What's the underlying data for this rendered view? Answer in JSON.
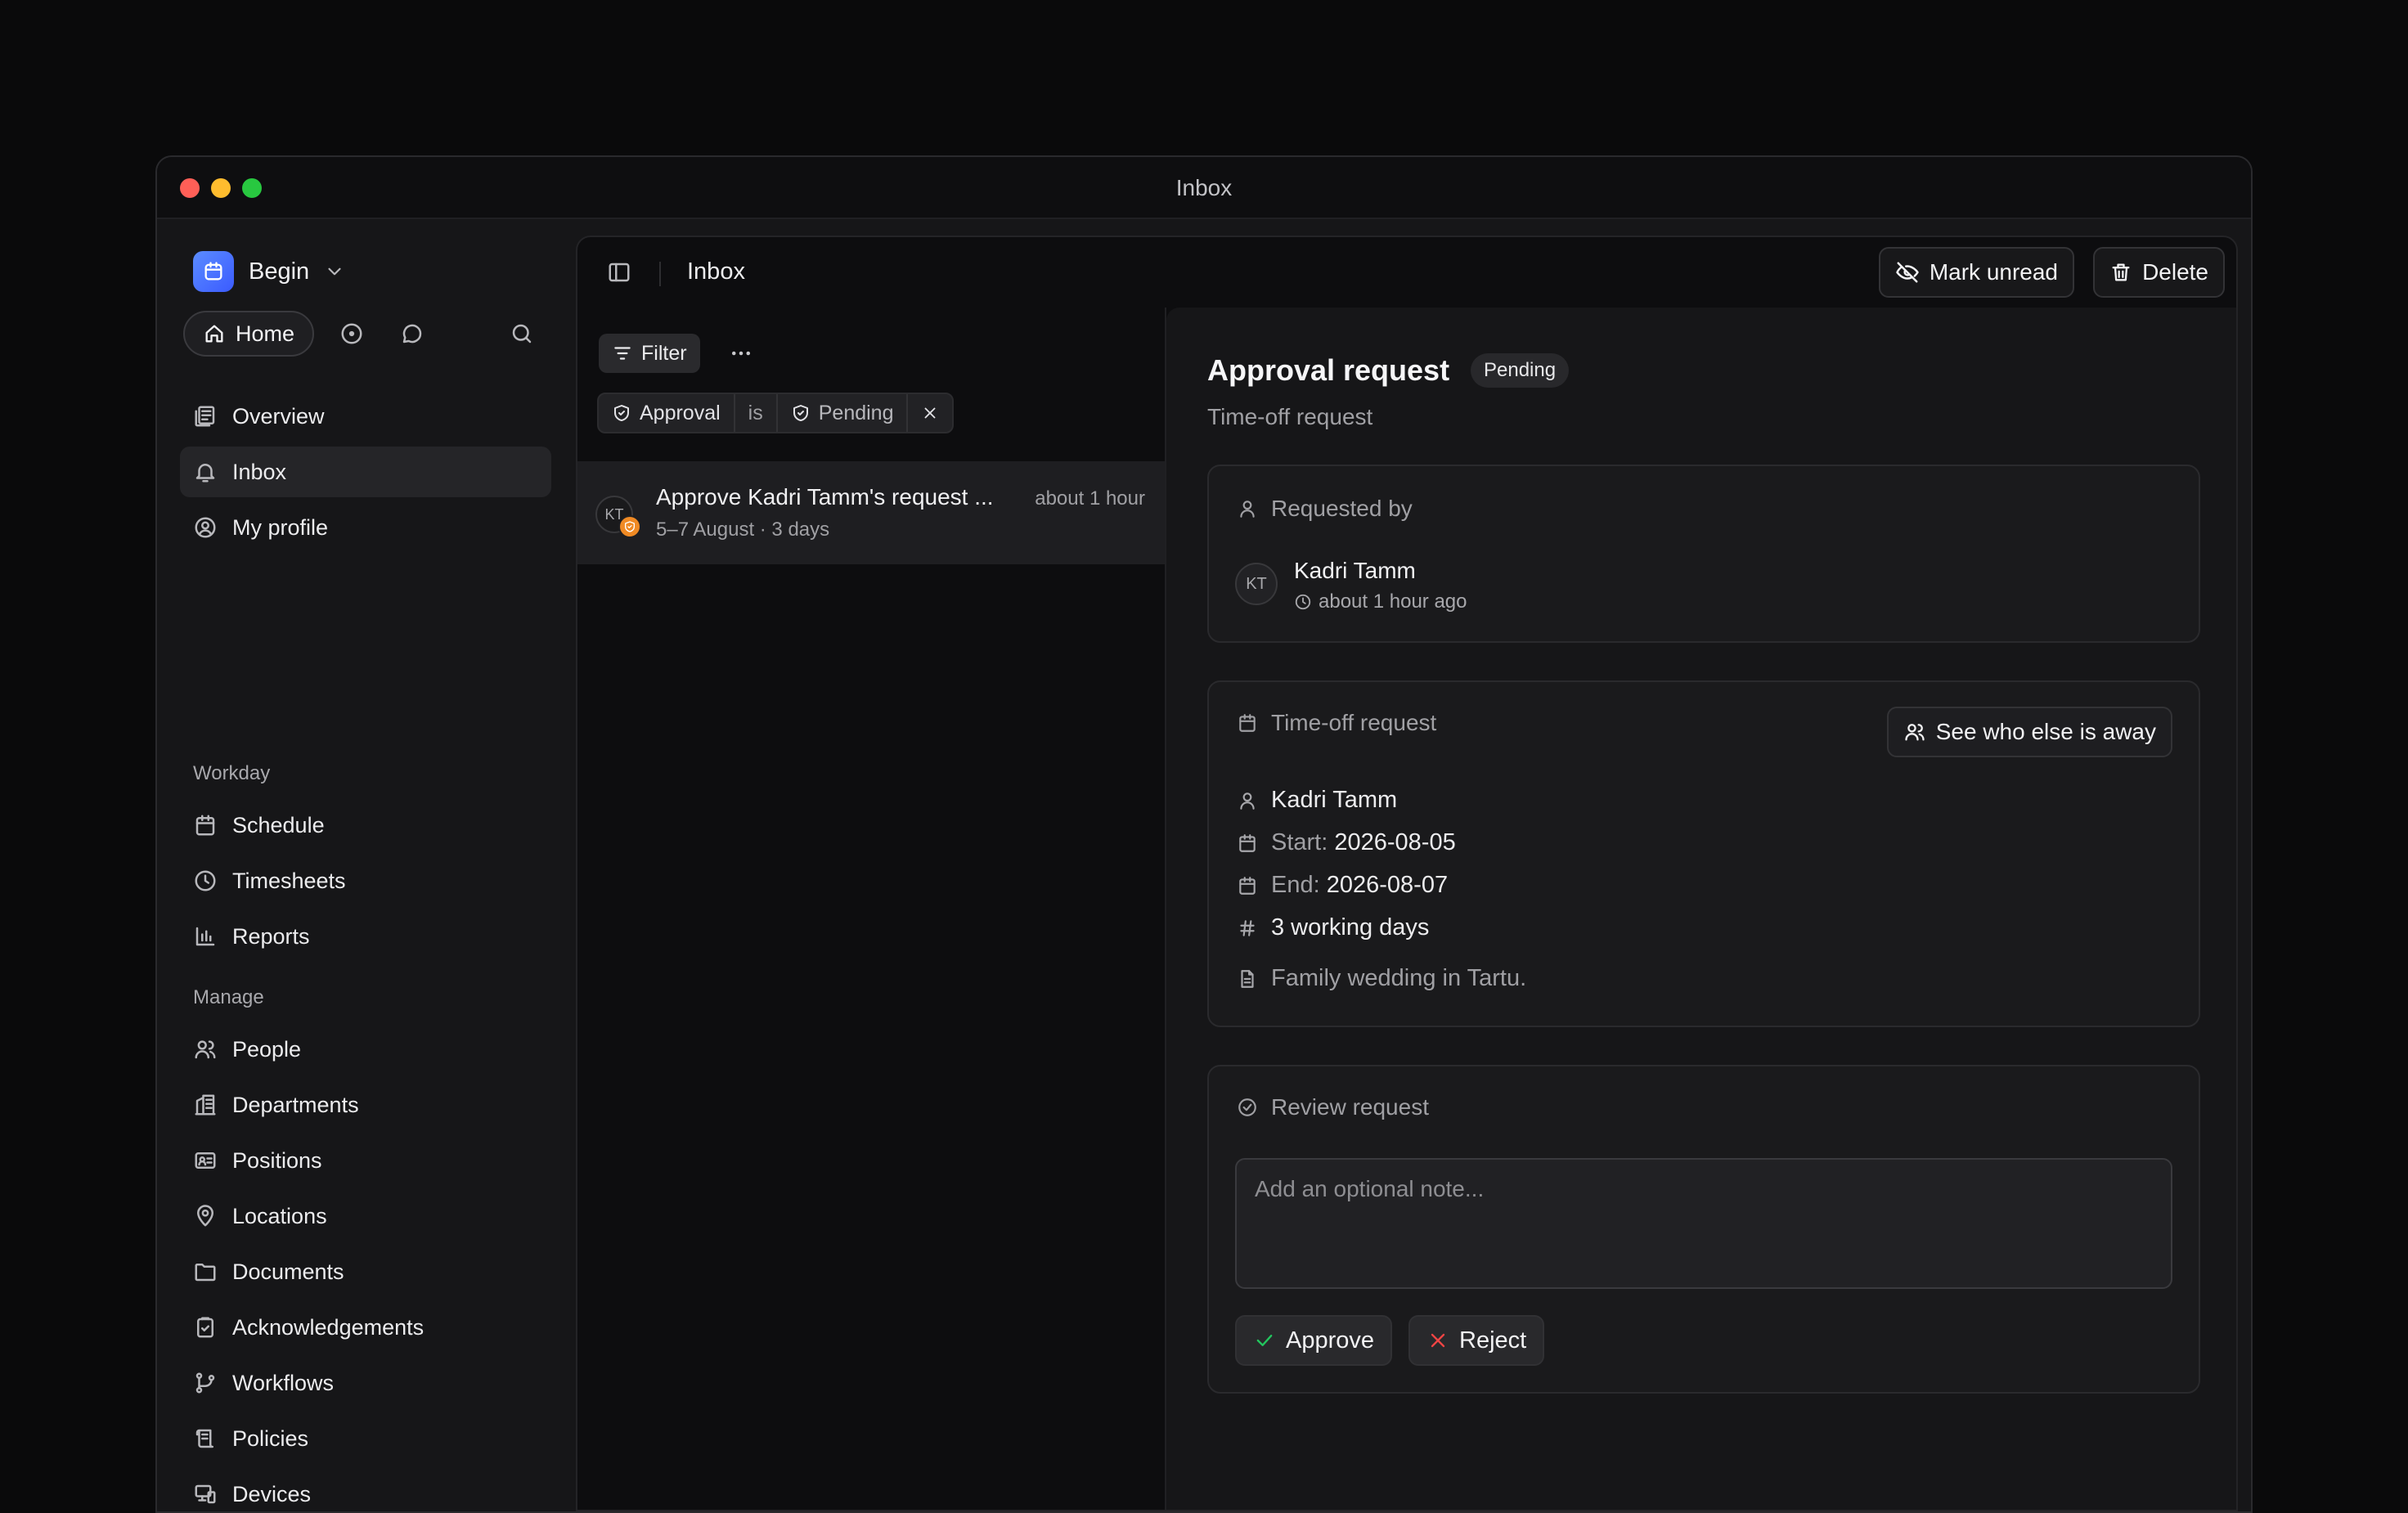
{
  "window": {
    "title": "Inbox"
  },
  "sidebar": {
    "workspace": "Begin",
    "home_label": "Home",
    "items_top": [
      {
        "label": "Overview",
        "icon": "overview-icon"
      },
      {
        "label": "Inbox",
        "icon": "bell-icon",
        "active": true
      },
      {
        "label": "My profile",
        "icon": "user-circle-icon"
      }
    ],
    "section_workday": "Workday",
    "items_workday": [
      {
        "label": "Schedule",
        "icon": "calendar-icon"
      },
      {
        "label": "Timesheets",
        "icon": "clock-icon"
      },
      {
        "label": "Reports",
        "icon": "bar-chart-icon"
      }
    ],
    "section_manage": "Manage",
    "items_manage": [
      {
        "label": "People",
        "icon": "users-icon"
      },
      {
        "label": "Departments",
        "icon": "building-icon"
      },
      {
        "label": "Positions",
        "icon": "id-card-icon"
      },
      {
        "label": "Locations",
        "icon": "map-pin-icon"
      },
      {
        "label": "Documents",
        "icon": "folder-icon"
      },
      {
        "label": "Acknowledgements",
        "icon": "clipboard-check-icon"
      },
      {
        "label": "Workflows",
        "icon": "git-branch-icon"
      },
      {
        "label": "Policies",
        "icon": "scroll-icon"
      },
      {
        "label": "Devices",
        "icon": "devices-icon"
      }
    ]
  },
  "main": {
    "title": "Inbox",
    "mark_unread_label": "Mark unread",
    "delete_label": "Delete"
  },
  "list": {
    "filter_label": "Filter",
    "chip": {
      "field": "Approval",
      "op": "is",
      "value": "Pending"
    },
    "item": {
      "avatar": "KT",
      "title": "Approve Kadri Tamm's request ...",
      "time": "about 1 hour",
      "subtitle": "5–7 August · 3 days"
    }
  },
  "detail": {
    "title": "Approval request",
    "status": "Pending",
    "subtitle": "Time-off request",
    "requested_by": {
      "header": "Requested by",
      "avatar": "KT",
      "name": "Kadri Tamm",
      "time": "about 1 hour ago"
    },
    "timeoff": {
      "header": "Time-off request",
      "see_label": "See who else is away",
      "person": "Kadri Tamm",
      "start_label": "Start:",
      "start": "2026-08-05",
      "end_label": "End:",
      "end": "2026-08-07",
      "days": "3 working days",
      "note": "Family wedding in Tartu."
    },
    "review": {
      "header": "Review request",
      "placeholder": "Add an optional note...",
      "approve_label": "Approve",
      "reject_label": "Reject",
      "approve_color": "#22c55e",
      "reject_color": "#ef4444"
    }
  }
}
